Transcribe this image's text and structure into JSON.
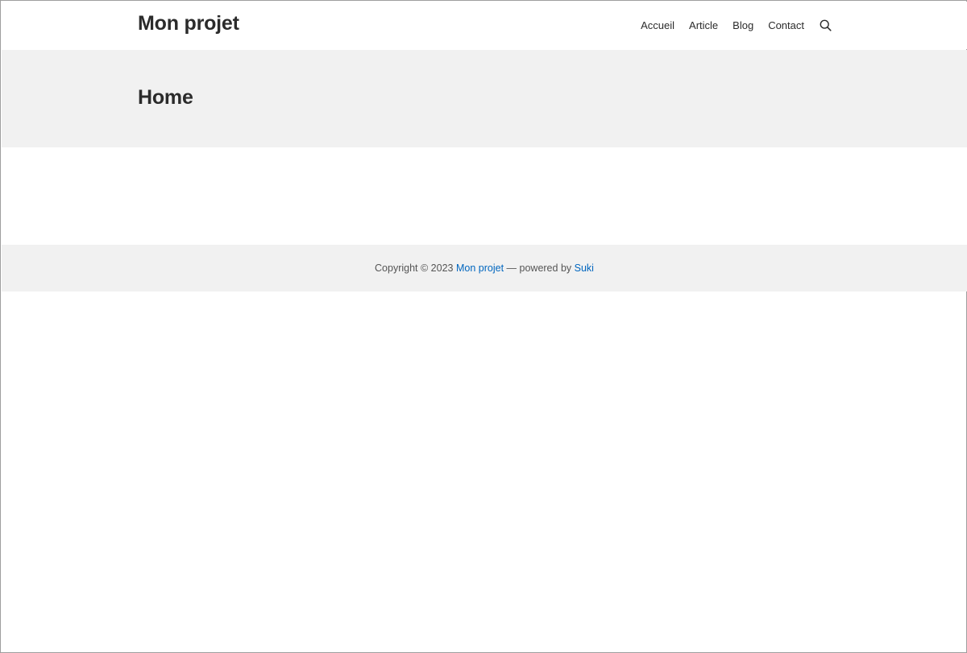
{
  "header": {
    "site_title": "Mon projet",
    "nav": [
      {
        "label": "Accueil"
      },
      {
        "label": "Article"
      },
      {
        "label": "Blog"
      },
      {
        "label": "Contact"
      }
    ],
    "search_icon": "search-icon"
  },
  "page": {
    "title": "Home"
  },
  "footer": {
    "copyright": "Copyright © 2023",
    "site_link": "Mon projet",
    "separator": "—",
    "powered_by": "powered by",
    "theme_link": "Suki"
  },
  "colors": {
    "link": "#0066bf",
    "band_background": "#f1f1f1",
    "text": "#2b2b2b"
  }
}
